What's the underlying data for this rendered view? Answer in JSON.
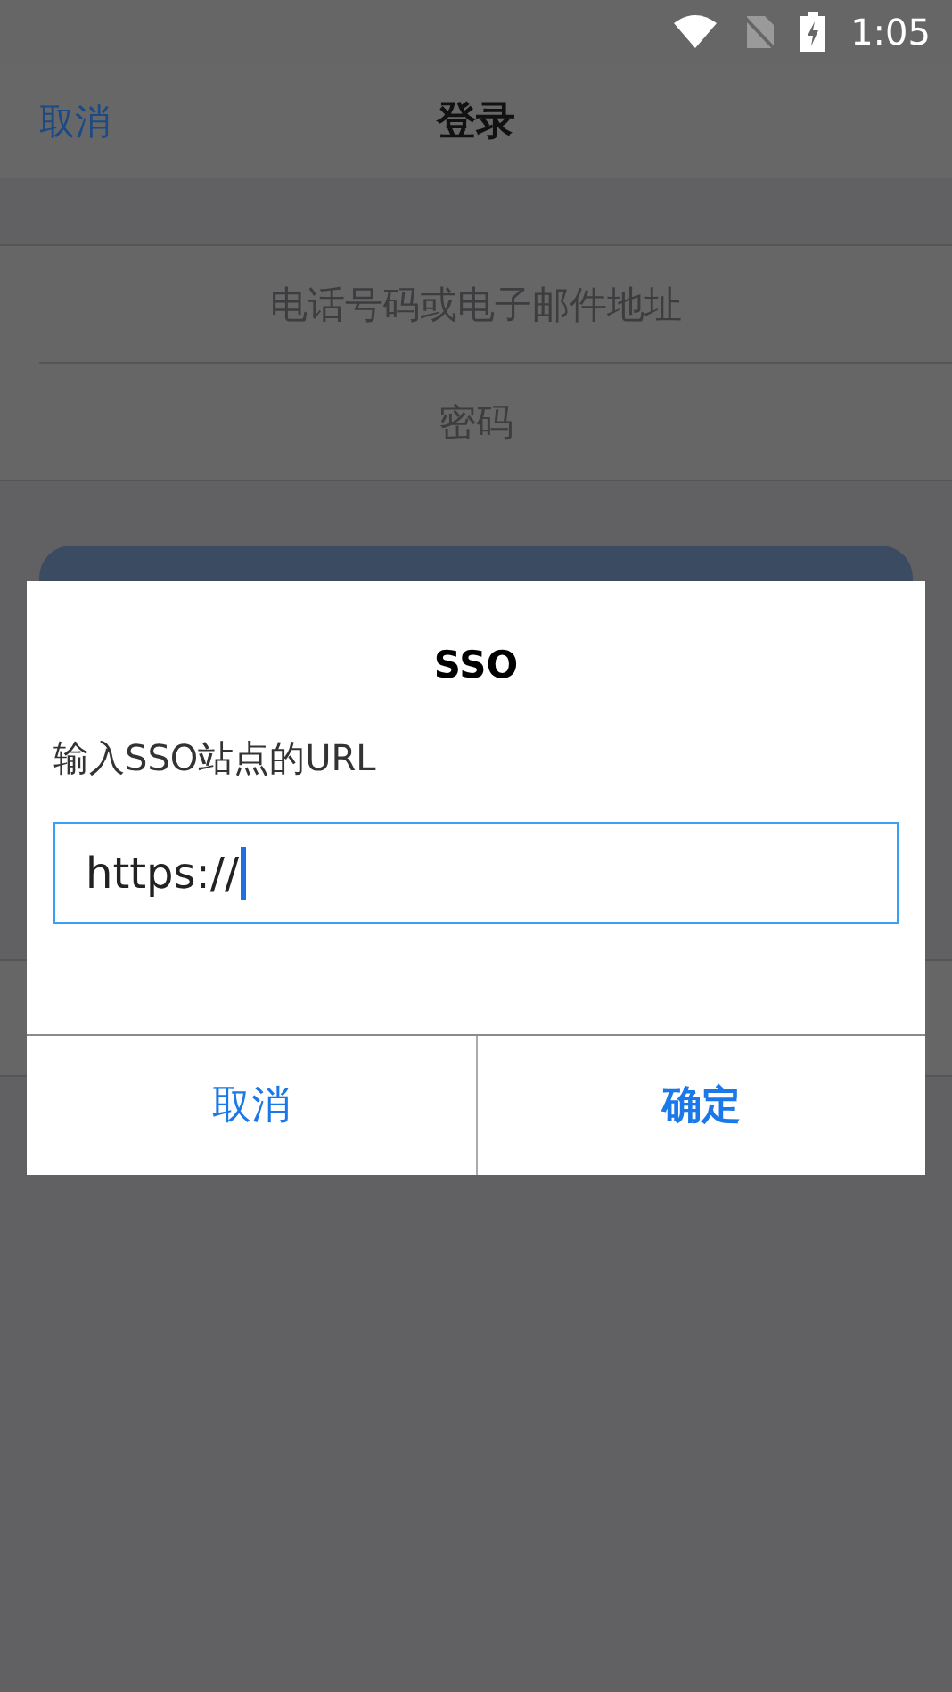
{
  "status_bar": {
    "time": "1:05"
  },
  "nav": {
    "cancel": "取消",
    "title": "登录"
  },
  "form": {
    "fields": [
      {
        "placeholder": "电话号码或电子邮件地址"
      },
      {
        "placeholder": "密码"
      }
    ]
  },
  "dialog": {
    "title": "SSO",
    "message": "输入SSO站点的URL",
    "input": {
      "value": "https://"
    },
    "buttons": [
      {
        "label": "取消",
        "kind": "cancel"
      },
      {
        "label": "确定",
        "kind": "confirm"
      }
    ]
  }
}
